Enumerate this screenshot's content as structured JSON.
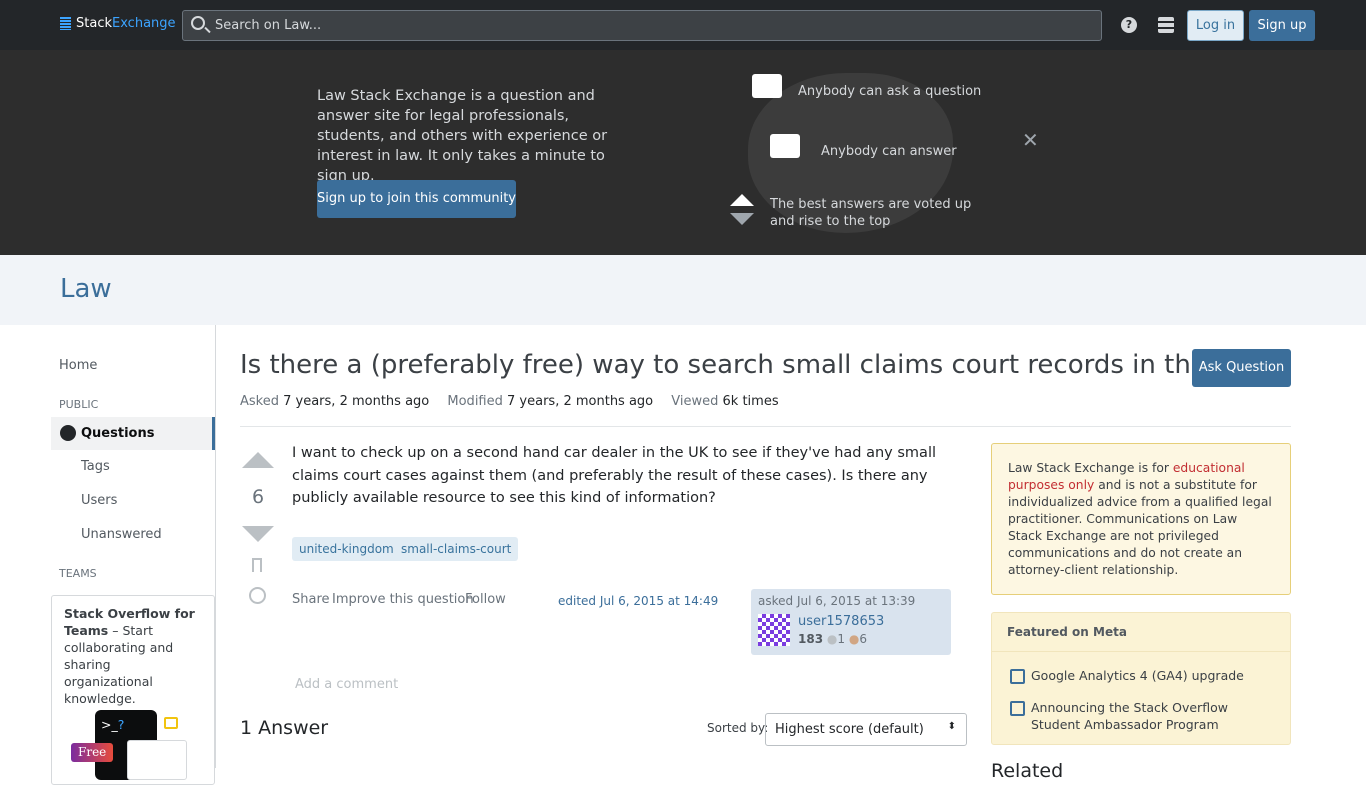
{
  "topbar": {
    "logo_a": "Stack",
    "logo_b": "Exchange",
    "search_placeholder": "Search on Law...",
    "help": "?",
    "login": "Log in",
    "signup": "Sign up"
  },
  "banner": {
    "text": "Law Stack Exchange is a question and answer site for legal professionals, students, and others with experience or interest in law. It only takes a minute to sign up.",
    "join": "Sign up to join this community",
    "f1": "Anybody can ask a question",
    "f2": "Anybody can answer",
    "f3": "The best answers are voted up and rise to the top",
    "close": "✕"
  },
  "site": {
    "name": "Law"
  },
  "sidebar": {
    "home": "Home",
    "public": "PUBLIC",
    "questions": "Questions",
    "tags": "Tags",
    "users": "Users",
    "unanswered": "Unanswered",
    "teams": "TEAMS",
    "teams_title": "Stack Overflow for Teams",
    "teams_text": " – Start collaborating and sharing organizational knowledge.",
    "free": "Free"
  },
  "question": {
    "title": "Is there a (preferably free) way to search small claims court records in the UK?",
    "ask_button": "Ask Question",
    "asked_label": "Asked",
    "asked": "7 years, 2 months ago",
    "modified_label": "Modified",
    "modified": "7 years, 2 months ago",
    "viewed_label": "Viewed",
    "viewed": "6k times",
    "score": "6",
    "body": "I want to check up on a second hand car dealer in the UK to see if they've had any small claims court cases against them (and preferably the result of these cases). Is there any publicly available resource to see this kind of information?",
    "tags": [
      "united-kingdom",
      "small-claims-court"
    ],
    "share": "Share",
    "improve": "Improve this question",
    "follow": "Follow",
    "edited": "edited Jul 6, 2015 at 14:49",
    "asked_card": "asked Jul 6, 2015 at 13:39",
    "user": "user1578653",
    "rep": "183",
    "silver": "1",
    "bronze": "6",
    "add_comment": "Add a comment"
  },
  "answers": {
    "count": "1 Answer",
    "sorted_by": "Sorted by:",
    "sort_value": "Highest score (default)"
  },
  "notice": {
    "a": "Law Stack Exchange is for ",
    "b": "educational purposes only",
    "c": " and is not a substitute for individualized advice from a qualified legal practitioner. Communications on Law Stack Exchange are not privileged communications and do not create an attorney-client relationship."
  },
  "featured": {
    "title": "Featured on Meta",
    "items": [
      "Google Analytics 4 (GA4) upgrade",
      "Announcing the Stack Overflow Student Ambassador Program"
    ]
  },
  "related": "Related"
}
